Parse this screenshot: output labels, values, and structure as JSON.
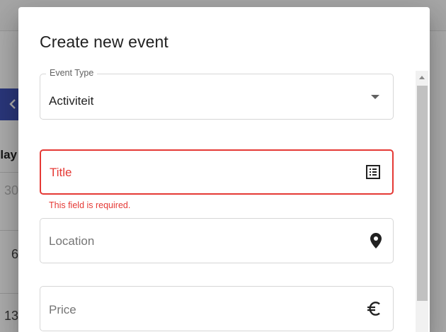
{
  "background": {
    "day_fragment": "lay",
    "dates": [
      "30",
      "6",
      "13"
    ],
    "nav_prev_icon": "chevron-left-icon"
  },
  "dialog": {
    "title": "Create new event",
    "fields": {
      "event_type": {
        "label": "Event Type",
        "value": "Activiteit",
        "icon": "dropdown-arrow-icon"
      },
      "title": {
        "placeholder": "Title",
        "error": "This field is required.",
        "icon": "list-icon"
      },
      "location": {
        "placeholder": "Location",
        "icon": "location-pin-icon"
      },
      "price": {
        "placeholder": "Price",
        "icon": "euro-icon"
      }
    }
  },
  "colors": {
    "accent": "#3f51b5",
    "error": "#e53935",
    "text": "#212121",
    "muted": "#757575"
  }
}
